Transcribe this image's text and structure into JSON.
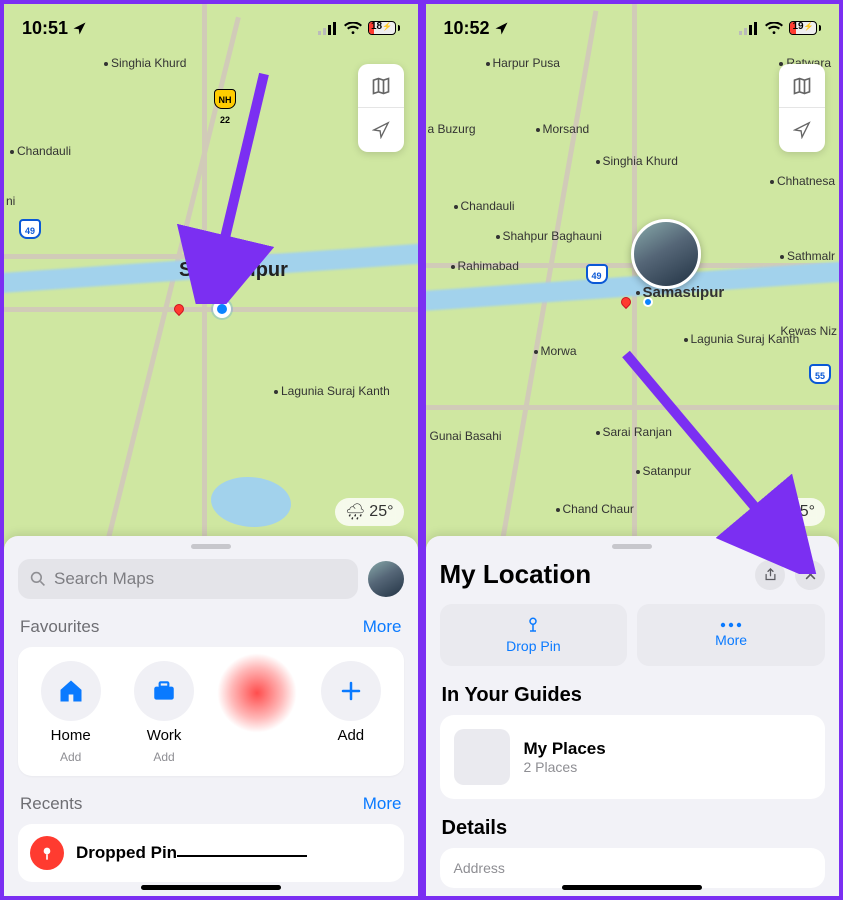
{
  "left": {
    "status": {
      "time": "10:51",
      "battery_pct": "18",
      "battery_charging": true
    },
    "map": {
      "city": "Samastipur",
      "highway1": "NH 22",
      "highway2": "49",
      "places": [
        "Singhia Khurd",
        "Chandauli",
        "ni",
        "Lagunia Suraj Kanth"
      ],
      "weather": "25°"
    },
    "sheet": {
      "search_placeholder": "Search Maps",
      "favourites_label": "Favourites",
      "more_label": "More",
      "fav_home": "Home",
      "fav_work": "Work",
      "fav_add": "Add",
      "fav_sub_add": "Add",
      "recents_label": "Recents",
      "dropped_pin": "Dropped Pin"
    }
  },
  "right": {
    "status": {
      "time": "10:52",
      "battery_pct": "19",
      "battery_charging": true
    },
    "map": {
      "highway1": "49",
      "highway2": "55",
      "places": [
        "Harpur Pusa",
        "Ratwara",
        "a Buzurg",
        "Morsand",
        "Singhia Khurd",
        "Chandauli",
        "Shahpur Baghauni",
        "Chhatnesa",
        "Rahimabad",
        "Samastipur",
        "Sathmalr",
        "Morwa",
        "Lagunia Suraj Kanth",
        "Kewas Niz",
        "Gunai Basahi",
        "Sarai Ranjan",
        "Satanpur",
        "Chand Chaur"
      ],
      "weather": "25°"
    },
    "sheet": {
      "title": "My Location",
      "drop_pin": "Drop Pin",
      "more": "More",
      "in_guides": "In Your Guides",
      "guide_name": "My Places",
      "guide_count": "2 Places",
      "details": "Details",
      "address_label": "Address"
    }
  }
}
